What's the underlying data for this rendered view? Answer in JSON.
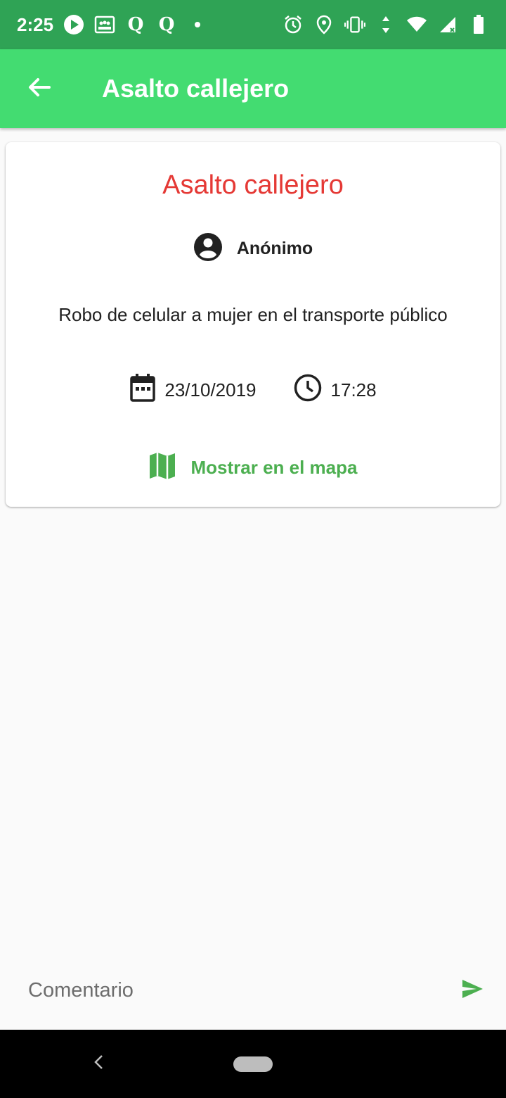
{
  "status_bar": {
    "time": "2:25",
    "q1": "Q",
    "q2": "Q",
    "icons_left": [
      "play-icon",
      "media-icon",
      "q-icon",
      "q-icon",
      "dot-icon"
    ],
    "icons_right": [
      "alarm-icon",
      "location-icon",
      "vibrate-icon",
      "data-arrows-icon",
      "wifi-icon",
      "signal-icon",
      "battery-icon"
    ]
  },
  "app_bar": {
    "title": "Asalto callejero",
    "back_icon": "arrow-back-icon"
  },
  "report": {
    "title": "Asalto callejero",
    "author": "Anónimo",
    "description": "Robo de celular a mujer en el transporte público",
    "date": "23/10/2019",
    "time": "17:28",
    "map_link": "Mostrar en el mapa"
  },
  "comment": {
    "placeholder": "Comentario",
    "value": ""
  },
  "colors": {
    "status_bar": "#2fa355",
    "app_bar": "#43dc71",
    "title_red": "#e53935",
    "accent_green": "#4caf50"
  }
}
